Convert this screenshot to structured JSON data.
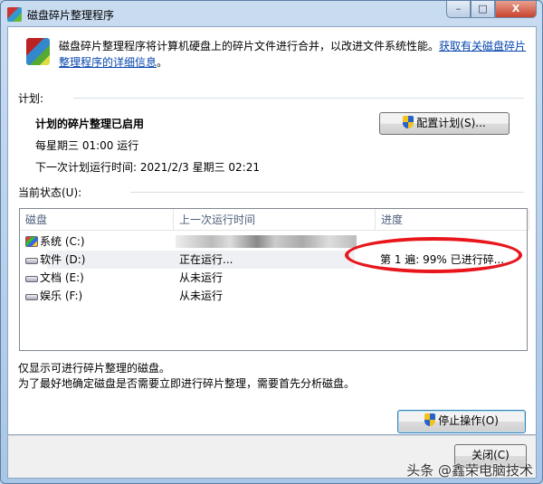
{
  "window": {
    "title": "磁盘碎片整理程序",
    "min": "–",
    "max": "□",
    "close": "X"
  },
  "description": {
    "text": "磁盘碎片整理程序将计算机硬盘上的碎片文件进行合并，以改进文件系统性能。",
    "link": "获取有关磁盘碎片整理程序的详细信息",
    "end": "。"
  },
  "schedule": {
    "label": "计划:",
    "status": "计划的碎片整理已启用",
    "frequency": "每星期三  01:00 运行",
    "next_run": "下一次计划运行时间: 2021/2/3 星期三 02:21",
    "configure_button": "配置计划(S)..."
  },
  "current_status": {
    "label": "当前状态(U):"
  },
  "table": {
    "columns": [
      "磁盘",
      "上一次运行时间",
      "进度"
    ],
    "rows": [
      {
        "disk": "系统 (C:)",
        "last_run": "",
        "progress": ""
      },
      {
        "disk": "软件 (D:)",
        "last_run": "正在运行...",
        "progress": "第 1 遍: 99% 已进行碎..."
      },
      {
        "disk": "文档 (E:)",
        "last_run": "从未运行",
        "progress": ""
      },
      {
        "disk": "娱乐 (F:)",
        "last_run": "从未运行",
        "progress": ""
      }
    ]
  },
  "notes": {
    "line1": "仅显示可进行碎片整理的磁盘。",
    "line2": "为了最好地确定磁盘是否需要立即进行碎片整理，需要首先分析磁盘。"
  },
  "buttons": {
    "stop": "停止操作(O)",
    "close": "关闭(C)"
  },
  "watermark": "头条 @鑫荣电脑技术"
}
